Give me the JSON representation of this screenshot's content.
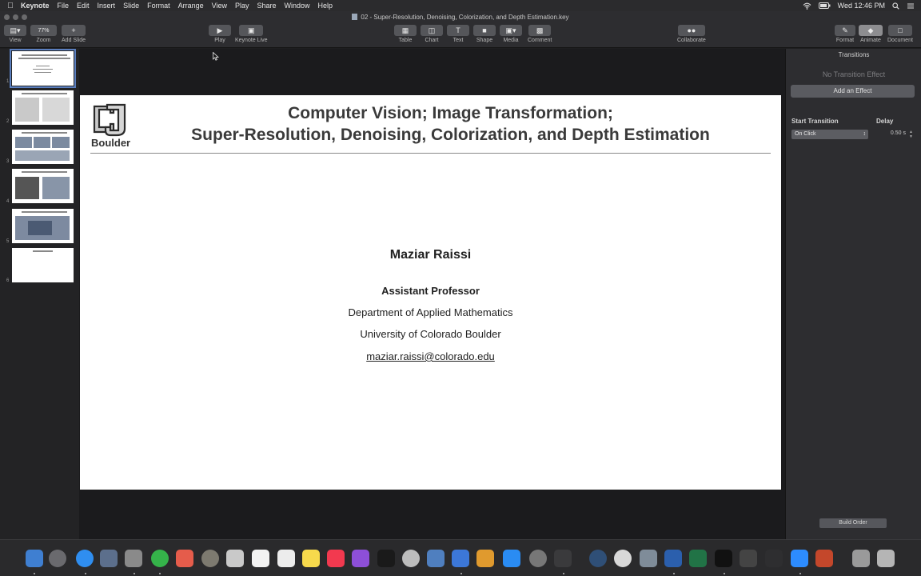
{
  "menubar": {
    "app_name": "Keynote",
    "items": [
      "File",
      "Edit",
      "Insert",
      "Slide",
      "Format",
      "Arrange",
      "View",
      "Play",
      "Share",
      "Window",
      "Help"
    ],
    "clock": "Wed 12:46 PM"
  },
  "window": {
    "document_title": "02 - Super-Resolution, Denoising, Colorization, and Depth Estimation.key"
  },
  "toolbar": {
    "view": "View",
    "zoom": "Zoom",
    "zoom_value": "77%",
    "add_slide": "Add Slide",
    "play": "Play",
    "keynote_live": "Keynote Live",
    "table": "Table",
    "chart": "Chart",
    "text": "Text",
    "shape": "Shape",
    "media": "Media",
    "comment": "Comment",
    "collaborate": "Collaborate",
    "format": "Format",
    "animate": "Animate",
    "document": "Document"
  },
  "navigator": {
    "slide_numbers": [
      "1",
      "2",
      "3",
      "4",
      "5",
      "6"
    ],
    "selected_index": 1
  },
  "slide": {
    "logo_text": "Boulder",
    "title_line1": "Computer Vision; Image Transformation;",
    "title_line2": "Super-Resolution, Denoising, Colorization, and Depth Estimation",
    "author": "Maziar Raissi",
    "role": "Assistant Professor",
    "department": "Department of Applied Mathematics",
    "university": "University of Colorado Boulder",
    "email": "maziar.raissi@colorado.edu"
  },
  "inspector": {
    "tab_label": "Transitions",
    "no_effect": "No Transition Effect",
    "add_effect": "Add an Effect",
    "start_label": "Start Transition",
    "start_value": "On Click",
    "delay_label": "Delay",
    "delay_value": "0.50 s",
    "build_order": "Build Order"
  },
  "colors": {
    "accent": "#5b7fbf",
    "chrome": "#2d2d30"
  }
}
